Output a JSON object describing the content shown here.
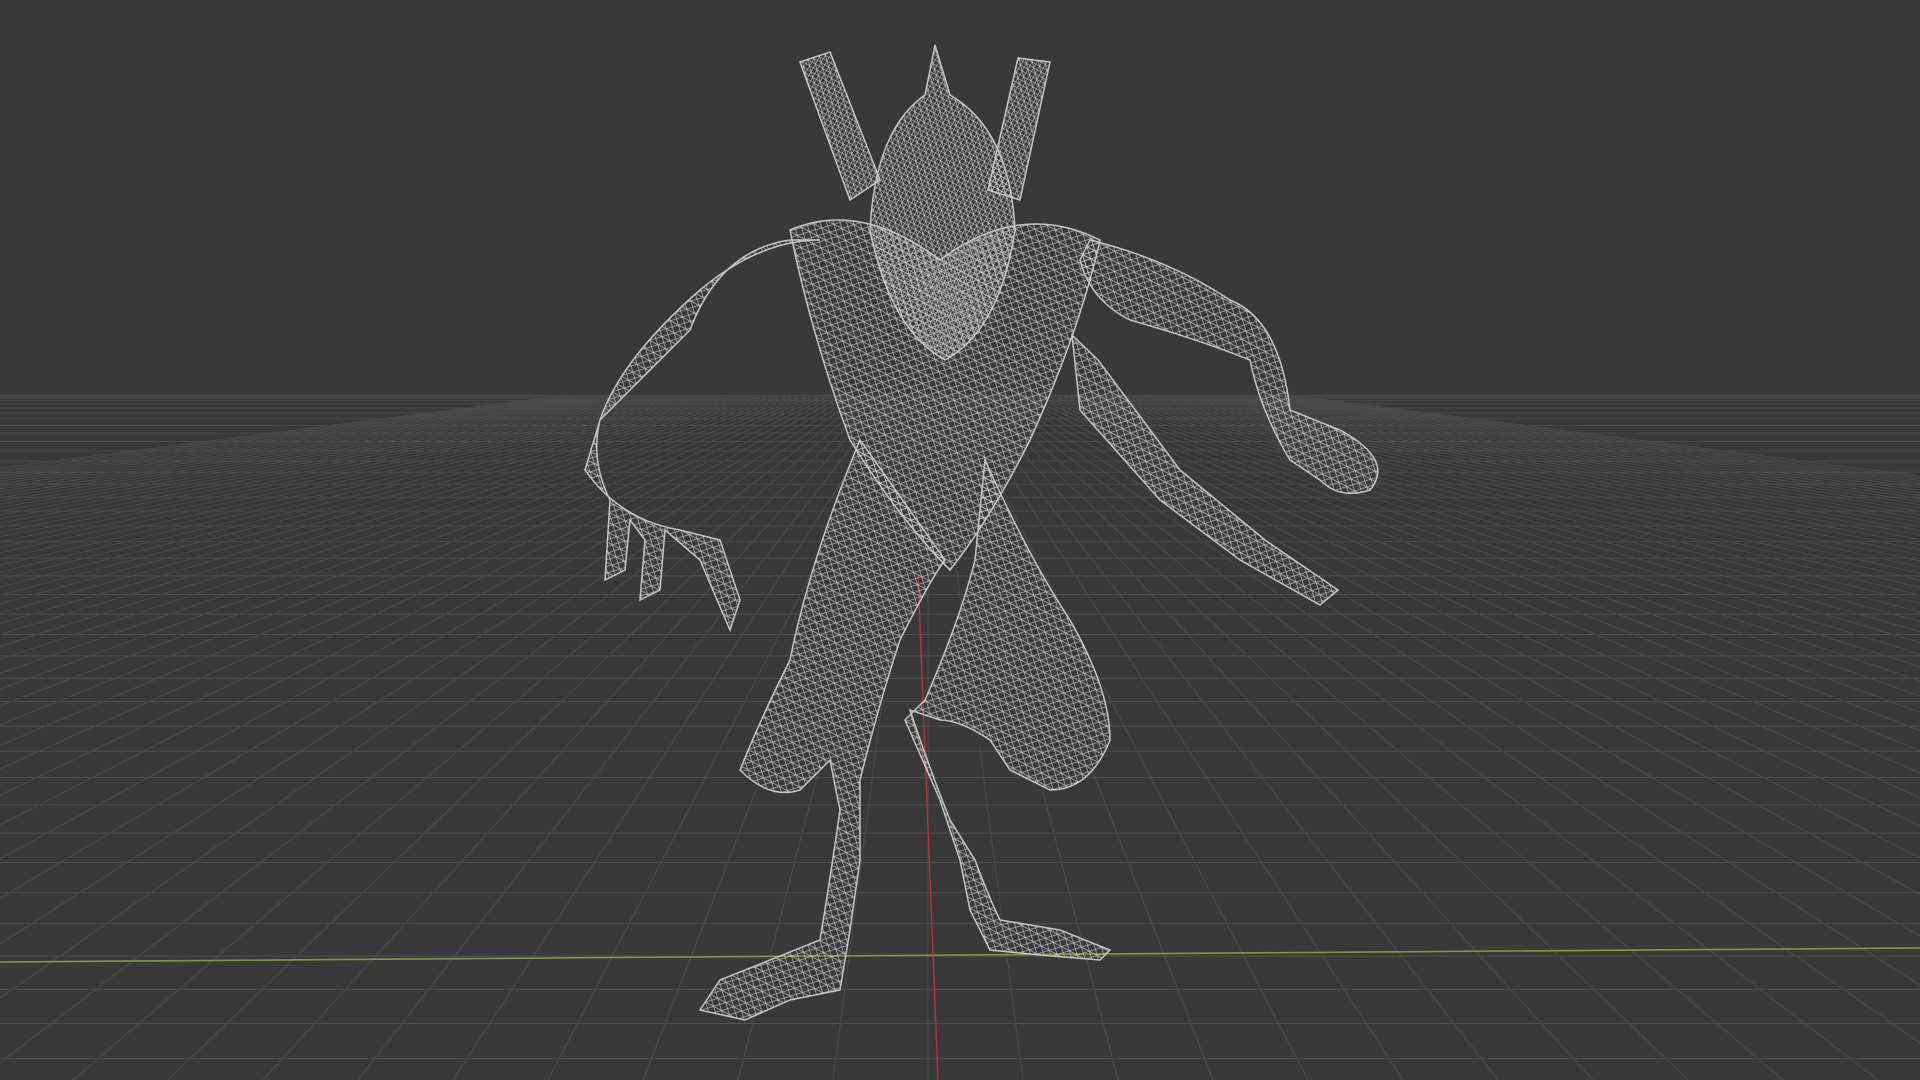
{
  "viewport": {
    "mode": "wireframe",
    "colors": {
      "background": "#393939",
      "grid_line": "#4a4a4a",
      "grid_line_near": "#525252",
      "axis_x": "#7d9b32",
      "axis_y": "#b03545",
      "wireframe": "#c8c8c8"
    }
  },
  "model": {
    "object": "creature-mesh"
  }
}
